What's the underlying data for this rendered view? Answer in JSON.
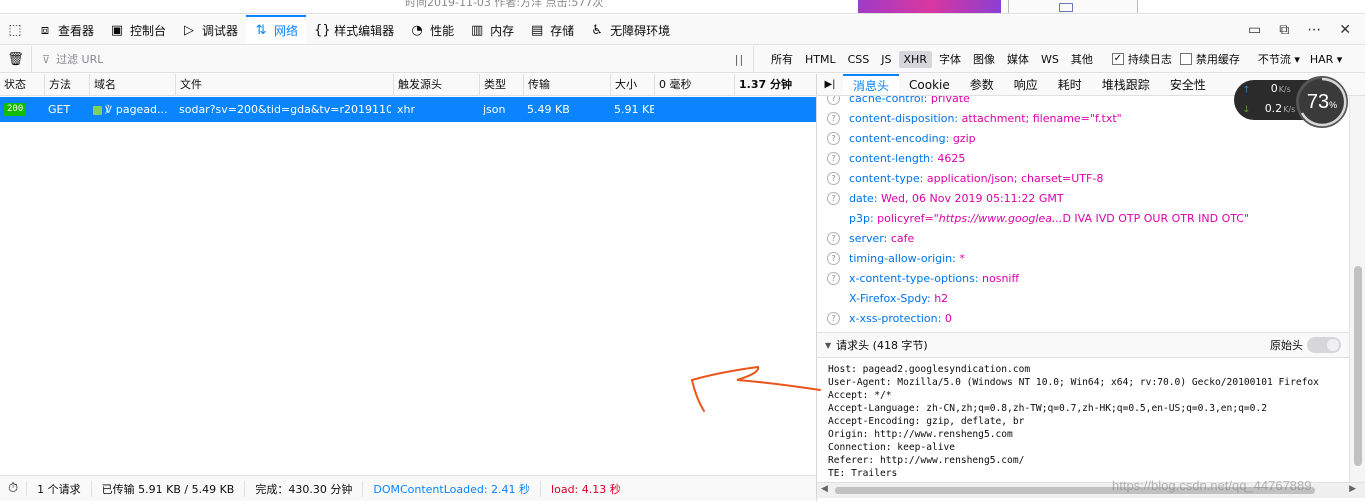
{
  "webpage": {
    "sliver_text": "时间2019-11-03   作者:方洋   点击:577次"
  },
  "toolbox": {
    "tabs": [
      {
        "label": "查看器",
        "icon": "inspector-icon"
      },
      {
        "label": "控制台",
        "icon": "console-icon"
      },
      {
        "label": "调试器",
        "icon": "debugger-icon"
      },
      {
        "label": "网络",
        "icon": "network-icon",
        "active": true
      },
      {
        "label": "样式编辑器",
        "icon": "style-editor-icon"
      },
      {
        "label": "性能",
        "icon": "performance-icon"
      },
      {
        "label": "内存",
        "icon": "memory-icon"
      },
      {
        "label": "存储",
        "icon": "storage-icon"
      },
      {
        "label": "无障碍环境",
        "icon": "accessibility-icon"
      }
    ]
  },
  "net_toolbar": {
    "filter_placeholder": "过滤 URL",
    "types": [
      "所有",
      "HTML",
      "CSS",
      "JS",
      "XHR",
      "字体",
      "图像",
      "媒体",
      "WS",
      "其他"
    ],
    "active_type": "XHR",
    "persist_logs": "持续日志",
    "persist_logs_checked": true,
    "disable_cache": "禁用缓存",
    "disable_cache_checked": false,
    "throttling": "不节流 ▾",
    "har": "HAR ▾"
  },
  "table": {
    "columns": [
      "状态",
      "方法",
      "域名",
      "文件",
      "触发源头",
      "类型",
      "传输",
      "大小",
      "0 毫秒",
      "1.37 分钟"
    ],
    "rows": [
      {
        "status": "200",
        "method": "GET",
        "domain": "pagead...",
        "file": "sodar?sv=200&tid=gda&tv=r2019110...",
        "cause": "xhr",
        "type": "json",
        "transferred": "5.49 KB",
        "size": "5.91 KB"
      }
    ]
  },
  "statusbar": {
    "requests": "1 个请求",
    "transferred": "已传输 5.91 KB / 5.49 KB",
    "finish": "完成：430.30 分钟",
    "dcl": "DOMContentLoaded: 2.41 秒",
    "load": "load: 4.13 秒"
  },
  "details": {
    "tabs": [
      "消息头",
      "Cookie",
      "参数",
      "响应",
      "耗时",
      "堆栈跟踪",
      "安全性"
    ],
    "active_tab": "消息头",
    "response_headers": [
      {
        "name": "cache-control:",
        "value": "private",
        "help": true
      },
      {
        "name": "content-disposition:",
        "value": "attachment; filename=\"f.txt\"",
        "help": true
      },
      {
        "name": "content-encoding:",
        "value": "gzip",
        "help": true
      },
      {
        "name": "content-length:",
        "value": "4625",
        "help": true
      },
      {
        "name": "content-type:",
        "value": "application/json; charset=UTF-8",
        "help": true
      },
      {
        "name": "date:",
        "value": "Wed, 06 Nov 2019 05:11:22 GMT",
        "help": true
      },
      {
        "name": "p3p:",
        "value": "policyref=\"https://www.googlea...D IVA IVD OTP OUR OTR IND OTC\"",
        "help": false
      },
      {
        "name": "server:",
        "value": "cafe",
        "help": true
      },
      {
        "name": "timing-allow-origin:",
        "value": "*",
        "help": true
      },
      {
        "name": "x-content-type-options:",
        "value": "nosniff",
        "help": true
      },
      {
        "name": "X-Firefox-Spdy:",
        "value": "h2",
        "help": false
      },
      {
        "name": "x-xss-protection:",
        "value": "0",
        "help": true
      }
    ],
    "request_headers_title": "请求头 (418 字节)",
    "raw_label": "原始头",
    "raw_request_headers": [
      "Host: pagead2.googlesyndication.com",
      "User-Agent: Mozilla/5.0 (Windows NT 10.0; Win64; x64; rv:70.0) Gecko/20100101 Firefox",
      "Accept: */*",
      "Accept-Language: zh-CN,zh;q=0.8,zh-TW;q=0.7,zh-HK;q=0.5,en-US;q=0.3,en;q=0.2",
      "Accept-Encoding: gzip, deflate, br",
      "Origin: http://www.rensheng5.com",
      "Connection: keep-alive",
      "Referer: http://www.rensheng5.com/",
      "TE: Trailers"
    ]
  },
  "speed_widget": {
    "up": "0",
    "down": "0.2",
    "unit": "K/s",
    "percent": "73",
    "pct_sign": "%"
  },
  "watermark": "https://blog.csdn.net/qq_44767889",
  "colors": {
    "accent": "#0a84ff",
    "header_name": "#0074e8",
    "header_value": "#dd00a9",
    "status_ok": "#12bc00",
    "annotation": "#e8561c"
  }
}
